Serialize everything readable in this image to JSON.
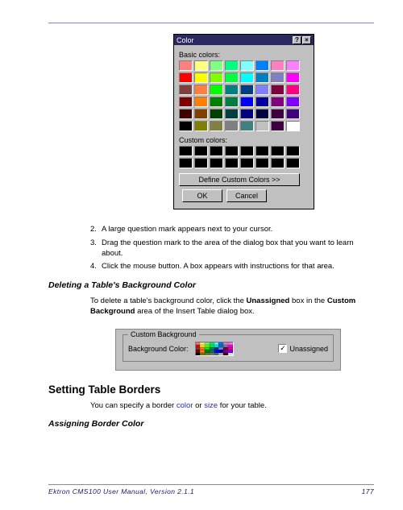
{
  "page": {
    "footer_left": "Ektron CMS100 User Manual, Version 2.1.1",
    "footer_right": "177"
  },
  "color_dialog": {
    "title": "Color",
    "help_btn": "?",
    "close_btn": "×",
    "basic_label": "Basic colors:",
    "custom_label": "Custom colors:",
    "define_btn": "Define Custom Colors >>",
    "ok_btn": "OK",
    "cancel_btn": "Cancel",
    "basic_colors": [
      "#ff8080",
      "#ffff80",
      "#80ff80",
      "#00ff80",
      "#80ffff",
      "#0080ff",
      "#ff80c0",
      "#ff80ff",
      "#ff0000",
      "#ffff00",
      "#80ff00",
      "#00ff40",
      "#00ffff",
      "#0080c0",
      "#8080c0",
      "#ff00ff",
      "#804040",
      "#ff8040",
      "#00ff00",
      "#008080",
      "#004080",
      "#8080ff",
      "#800040",
      "#ff0080",
      "#800000",
      "#ff8000",
      "#008000",
      "#008040",
      "#0000ff",
      "#0000a0",
      "#800080",
      "#8000ff",
      "#400000",
      "#804000",
      "#004000",
      "#004040",
      "#000080",
      "#000040",
      "#400040",
      "#400080",
      "#000000",
      "#808000",
      "#808040",
      "#808080",
      "#408080",
      "#c0c0c0",
      "#400040",
      "#ffffff"
    ],
    "custom_colors": [
      "#000000",
      "#000000",
      "#000000",
      "#000000",
      "#000000",
      "#000000",
      "#000000",
      "#000000",
      "#000000",
      "#000000",
      "#000000",
      "#000000",
      "#000000",
      "#000000",
      "#000000",
      "#000000"
    ]
  },
  "steps": [
    {
      "num": "2.",
      "text": "A large question mark appears next to your cursor."
    },
    {
      "num": "3.",
      "text": "Drag the question mark to the area of the dialog box that you want to learn about."
    },
    {
      "num": "4.",
      "text": "Click the mouse button. A box appears with instructions for that area."
    }
  ],
  "delete_heading": "Deleting a Table's Background Color",
  "delete_para_pre": "To delete a table's background color, click the ",
  "delete_para_b1": "Unassigned",
  "delete_para_mid": " box in the ",
  "delete_para_b2": "Custom Background",
  "delete_para_post": " area of the Insert Table dialog box.",
  "custom_bg": {
    "legend": "Custom Background",
    "label": "Background Color:",
    "checkbox_label": "Unassigned",
    "checked_mark": "✓"
  },
  "setting_heading": "Setting Table Borders",
  "setting_para_pre": "You can specify a border ",
  "setting_link1": "color",
  "setting_or": " or ",
  "setting_link2": "size",
  "setting_para_post": " for your table.",
  "assign_heading": "Assigning Border Color"
}
